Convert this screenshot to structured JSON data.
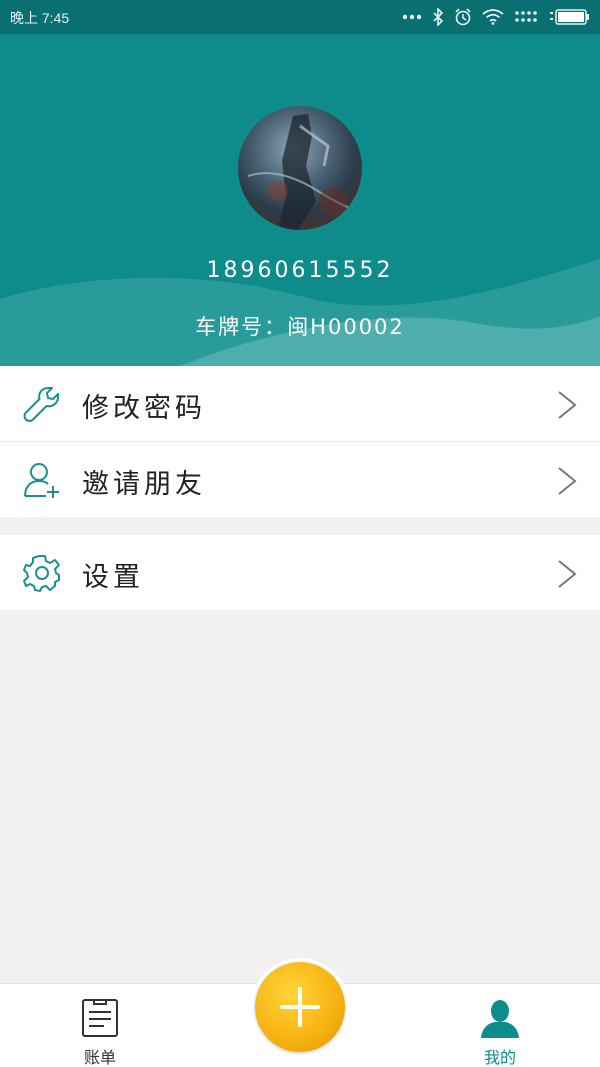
{
  "status_bar": {
    "time": "晚上 7:45",
    "icons": [
      "more-dots-icon",
      "bluetooth-icon",
      "alarm-icon",
      "wifi-icon",
      "signal-icon",
      "battery-icon"
    ]
  },
  "profile": {
    "phone": "18960615552",
    "plate_label": "车牌号：",
    "plate_value": "闽H00002"
  },
  "menu": [
    {
      "label": "修改密码",
      "icon": "wrench-icon"
    },
    {
      "label": "邀请朋友",
      "icon": "add-user-icon"
    },
    {
      "label": "设置",
      "icon": "gear-icon"
    }
  ],
  "tabbar": {
    "bill_label": "账单",
    "mine_label": "我的",
    "fab_icon": "plus-icon"
  },
  "colors": {
    "primary": "#0e8c8c",
    "fab": "#f8b414",
    "background": "#f1f1f1"
  }
}
